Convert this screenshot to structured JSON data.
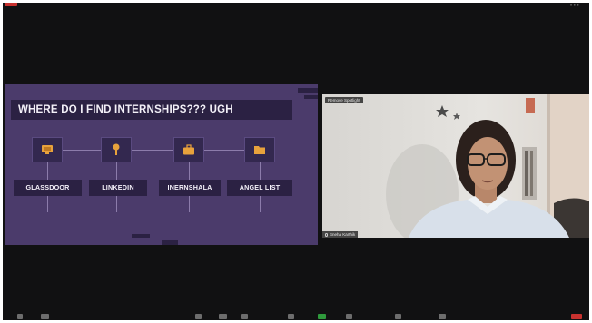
{
  "window": {
    "top_menu": "•••",
    "colors": {
      "badge": "#c8322f",
      "background": "#111112"
    }
  },
  "slide": {
    "title": "WHERE DO I FIND INTERNSHIPS??? UGH",
    "items": [
      {
        "label": "GLASSDOOR",
        "icon": "monitor-icon"
      },
      {
        "label": "LINKEDIN",
        "icon": "pin-icon"
      },
      {
        "label": "INERNSHALA",
        "icon": "briefcase-icon"
      },
      {
        "label": "ANGEL LIST",
        "icon": "folder-icon"
      }
    ],
    "colors": {
      "background": "#4b3b6b",
      "box": "#2b2143",
      "icon": "#e8a23c",
      "text": "#f5f2fa"
    }
  },
  "video": {
    "spotlight_label": "Remove Spotlight",
    "participant_name": "Sneha Karthik"
  },
  "toolbar": {
    "icons": [
      "mic-icon",
      "video-camera-icon",
      "security-icon",
      "participants-icon",
      "chat-icon",
      "share-screen-icon",
      "record-icon",
      "reactions-icon",
      "apps-icon",
      "more-icon",
      "end-call-icon"
    ]
  }
}
